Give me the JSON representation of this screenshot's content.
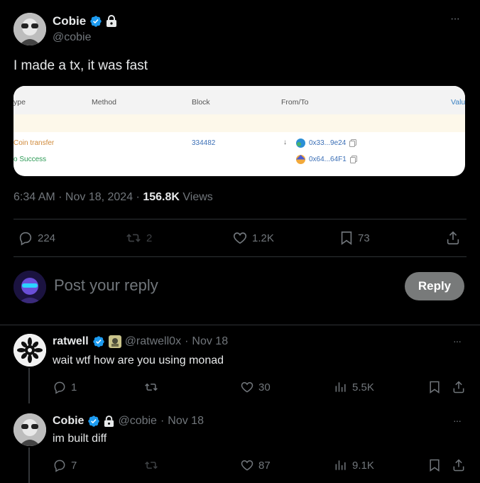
{
  "main_post": {
    "display_name": "Cobie",
    "handle": "@cobie",
    "text": "I made a tx, it was fast",
    "time": "6:34 AM",
    "date": "Nov 18, 2024",
    "views_count": "156.8K",
    "views_label": "Views",
    "more_label": "···",
    "stats": {
      "replies": "224",
      "reposts": "2",
      "likes": "1.2K",
      "bookmarks": "73"
    }
  },
  "embed": {
    "headers": {
      "type": "ype",
      "method": "Method",
      "block": "Block",
      "from_to": "From/To",
      "value": "Valu"
    },
    "row": {
      "type": "Coin transfer",
      "status": "Success",
      "block": "334482",
      "from": "0x33...9e24",
      "to": "0x64...64F1"
    }
  },
  "reply_composer": {
    "placeholder": "Post your reply",
    "button": "Reply"
  },
  "replies": [
    {
      "display_name": "ratwell",
      "handle": "@ratwell0x",
      "date": "Nov 18",
      "text": "wait wtf how are you using monad",
      "stats": {
        "replies": "1",
        "reposts": "",
        "likes": "30",
        "views": "5.5K"
      }
    },
    {
      "display_name": "Cobie",
      "handle": "@cobie",
      "date": "Nov 18",
      "text": "im built diff",
      "stats": {
        "replies": "7",
        "reposts": "",
        "likes": "87",
        "views": "9.1K"
      }
    }
  ],
  "colors": {
    "accent": "#1d9bf0",
    "background": "#000000",
    "divider": "#2f3336",
    "muted": "#71767b"
  }
}
